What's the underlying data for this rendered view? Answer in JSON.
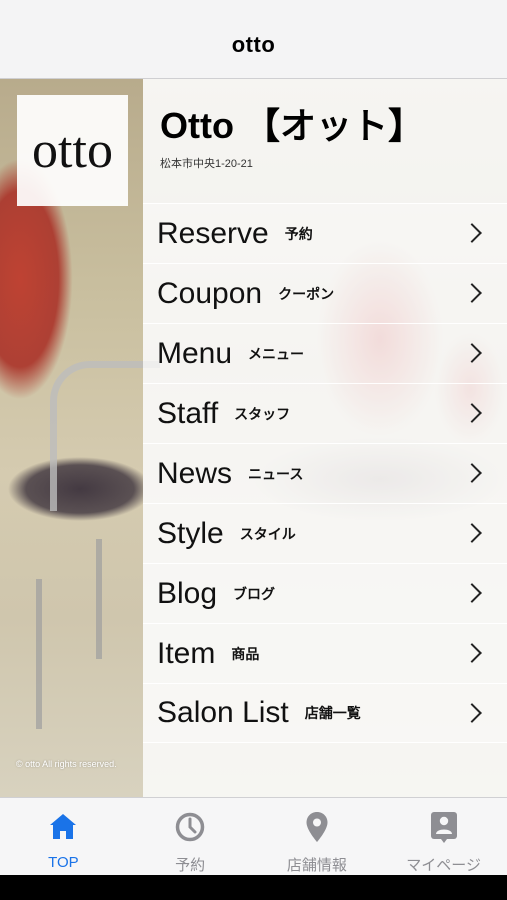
{
  "app": {
    "title": "otto"
  },
  "brand": {
    "logo_text": "otto",
    "copyright": "© otto All rights reserved."
  },
  "shop": {
    "name": "Otto 【オット】",
    "address": "松本市中央1-20-21"
  },
  "menu": [
    {
      "label": "Reserve",
      "sub": "予約"
    },
    {
      "label": "Coupon",
      "sub": "クーポン"
    },
    {
      "label": "Menu",
      "sub": "メニュー"
    },
    {
      "label": "Staff",
      "sub": "スタッフ"
    },
    {
      "label": "News",
      "sub": "ニュース"
    },
    {
      "label": "Style",
      "sub": "スタイル"
    },
    {
      "label": "Blog",
      "sub": "ブログ"
    },
    {
      "label": "Item",
      "sub": "商品"
    },
    {
      "label": "Salon List",
      "sub": "店舗一覧"
    }
  ],
  "tabs": [
    {
      "label": "TOP",
      "icon": "home-icon",
      "active": true
    },
    {
      "label": "予約",
      "icon": "clock-icon",
      "active": false
    },
    {
      "label": "店舗情報",
      "icon": "map-pin-icon",
      "active": false
    },
    {
      "label": "マイページ",
      "icon": "contact-card-icon",
      "active": false
    }
  ],
  "colors": {
    "active": "#1a73e8",
    "inactive": "#8e8e93",
    "navbar": "#f4f4f5"
  }
}
